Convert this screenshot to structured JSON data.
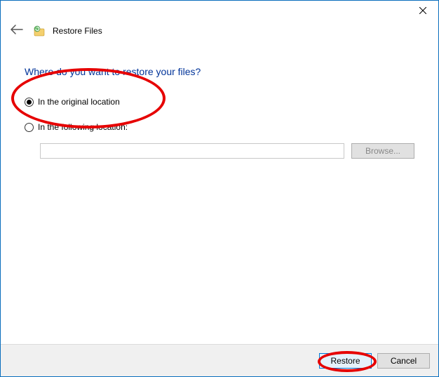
{
  "window": {
    "title": "Restore Files"
  },
  "content": {
    "heading": "Where do you want to restore your files?",
    "options": {
      "original": "In the original location",
      "following": "In the following location:"
    },
    "location_value": "",
    "browse_label": "Browse..."
  },
  "footer": {
    "primary_label": "Restore",
    "cancel_label": "Cancel"
  }
}
